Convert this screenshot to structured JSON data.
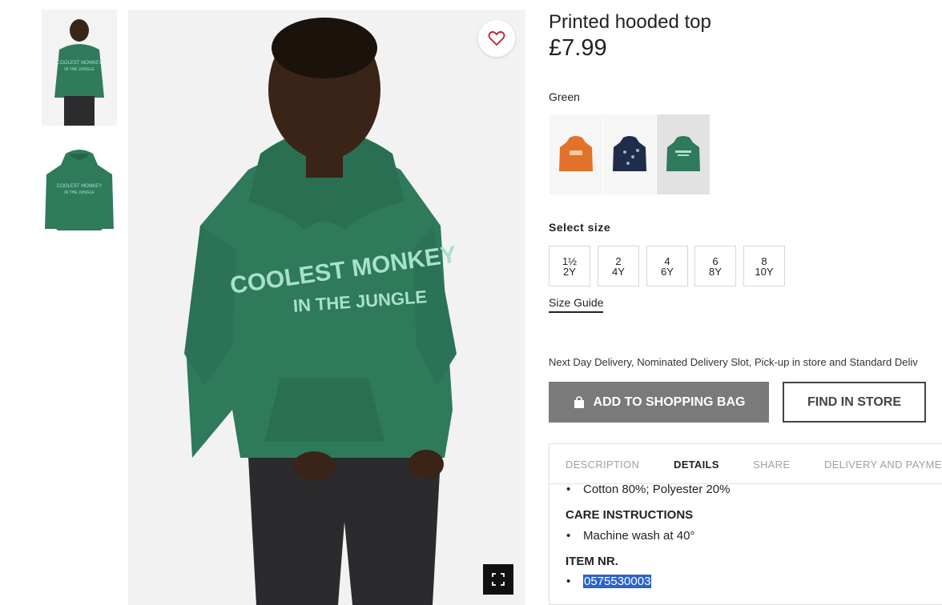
{
  "product": {
    "title": "Printed hooded top",
    "price": "£7.99",
    "selected_color": "Green"
  },
  "images": {
    "main_print_line1": "COOLEST MONKEY",
    "main_print_line2": "IN THE JUNGLE",
    "thumb_print_line1": "COOLEST MONKEY",
    "thumb_print_line2": "IN THE JUNGLE"
  },
  "color_swatches": [
    {
      "name": "orange-hoodie",
      "color": "#e2722a"
    },
    {
      "name": "navy-print-hoodie",
      "color": "#1f2d4a"
    },
    {
      "name": "green-hoodie",
      "color": "#2e7a5a",
      "selected": true
    }
  ],
  "size": {
    "label": "Select size",
    "options": [
      {
        "line1": "1½",
        "line2": "2Y"
      },
      {
        "line1": "2",
        "line2": "4Y"
      },
      {
        "line1": "4",
        "line2": "6Y"
      },
      {
        "line1": "6",
        "line2": "8Y"
      },
      {
        "line1": "8",
        "line2": "10Y"
      }
    ],
    "guide_link": "Size Guide"
  },
  "delivery_text": "Next Day Delivery, Nominated Delivery Slot, Pick-up in store and Standard Deliv",
  "actions": {
    "add_to_bag": "ADD TO SHOPPING BAG",
    "find_in_store": "FIND IN STORE"
  },
  "tabs": [
    {
      "label": "DESCRIPTION",
      "active": false
    },
    {
      "label": "DETAILS",
      "active": true
    },
    {
      "label": "SHARE",
      "active": false
    },
    {
      "label": "DELIVERY AND PAYME",
      "active": false
    }
  ],
  "details": {
    "composition": "Cotton 80%; Polyester 20%",
    "care_heading": "CARE INSTRUCTIONS",
    "care_item": "Machine wash at 40°",
    "item_heading": "ITEM NR.",
    "item_number": "0575530003"
  },
  "colors": {
    "hoodie_green": "#2e7a5a",
    "print_mint": "#a8e0cf",
    "button_grey": "#7a7a7a",
    "selection_blue": "#2b63c7"
  }
}
